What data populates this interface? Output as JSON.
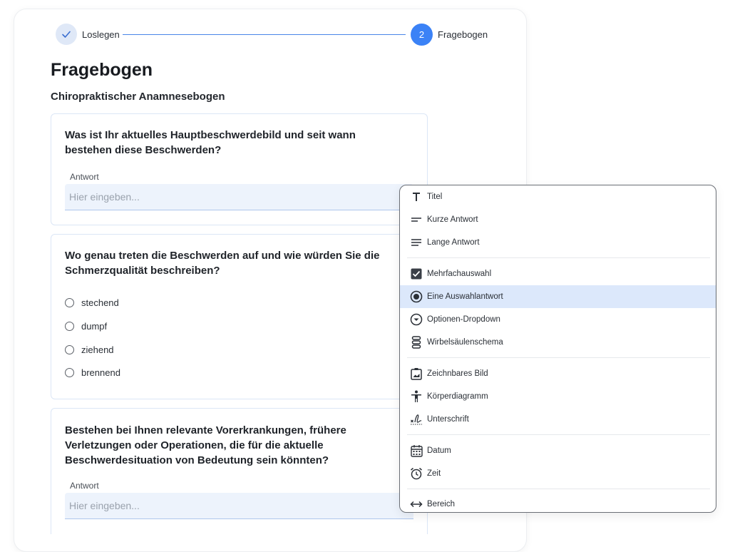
{
  "stepper": {
    "step1_label": "Loslegen",
    "step2_number": "2",
    "step2_label": "Fragebogen"
  },
  "page": {
    "title": "Fragebogen",
    "form_title": "Chiropraktischer Anamnesebogen"
  },
  "questions": [
    {
      "text": "Was ist Ihr aktuelles Hauptbeschwerdebild und seit wann bestehen diese Beschwerden?",
      "answer_label": "Antwort",
      "placeholder": "Hier eingeben..."
    },
    {
      "text": "Wo genau treten die Beschwerden auf und wie würden Sie die Schmerzqualität beschreiben?",
      "options": [
        "stechend",
        "dumpf",
        "ziehend",
        "brennend"
      ]
    },
    {
      "text": "Bestehen bei Ihnen relevante Vorerkrankungen, frühere Verletzungen oder Operationen, die für die aktuelle Beschwerdesituation von Bedeutung sein könnten?",
      "answer_label": "Antwort",
      "placeholder": "Hier eingeben..."
    }
  ],
  "menu": {
    "items": [
      {
        "label": "Titel",
        "icon": "title-icon"
      },
      {
        "label": "Kurze Antwort",
        "icon": "short-text-icon"
      },
      {
        "label": "Lange Antwort",
        "icon": "long-text-icon"
      },
      {
        "label": "Mehrfachauswahl",
        "icon": "checkbox-icon"
      },
      {
        "label": "Eine Auswahlantwort",
        "icon": "radio-icon",
        "selected": true
      },
      {
        "label": "Optionen-Dropdown",
        "icon": "dropdown-icon"
      },
      {
        "label": "Wirbelsäulenschema",
        "icon": "spine-icon"
      },
      {
        "label": "Zeichnbares Bild",
        "icon": "drawable-image-icon"
      },
      {
        "label": "Körperdiagramm",
        "icon": "body-icon"
      },
      {
        "label": "Unterschrift",
        "icon": "signature-icon"
      },
      {
        "label": "Datum",
        "icon": "calendar-icon"
      },
      {
        "label": "Zeit",
        "icon": "alarm-icon"
      },
      {
        "label": "Bereich",
        "icon": "range-icon"
      }
    ]
  },
  "colors": {
    "accent": "#3b82f6",
    "selected_bg": "#dce8fb",
    "input_bg": "#edf3fc"
  }
}
